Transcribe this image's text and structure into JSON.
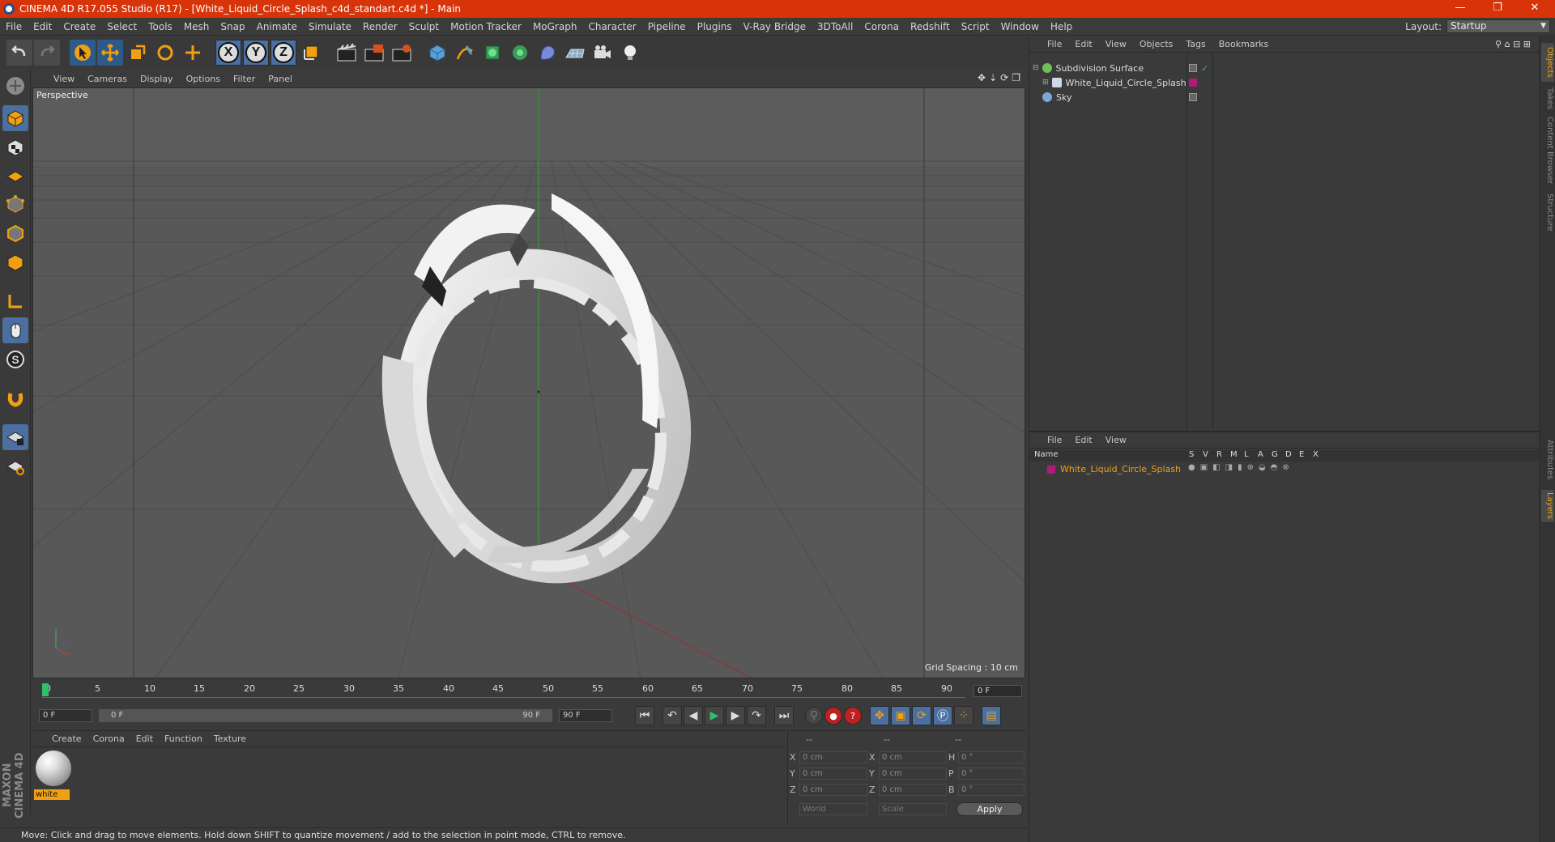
{
  "titlebar": {
    "title": "CINEMA 4D R17.055 Studio (R17) - [White_Liquid_Circle_Splash_c4d_standart.c4d *] - Main",
    "minimize": "—",
    "maximize": "❐",
    "close": "✕"
  },
  "menubar": {
    "items": [
      "File",
      "Edit",
      "Create",
      "Select",
      "Tools",
      "Mesh",
      "Snap",
      "Animate",
      "Simulate",
      "Render",
      "Sculpt",
      "Motion Tracker",
      "MoGraph",
      "Character",
      "Pipeline",
      "Plugins",
      "V-Ray Bridge",
      "3DToAll",
      "Corona",
      "Redshift",
      "Script",
      "Window",
      "Help"
    ],
    "layout_label": "Layout:",
    "layout_value": "Startup"
  },
  "viewport": {
    "menu": [
      "View",
      "Cameras",
      "Display",
      "Options",
      "Filter",
      "Panel"
    ],
    "camera_label": "Perspective",
    "grid_spacing": "Grid Spacing : 10 cm",
    "nav_icons": [
      "move-view-icon",
      "zoom-view-icon",
      "rotate-view-icon",
      "maximize-view-icon"
    ]
  },
  "timeline": {
    "ticks": [
      "0",
      "5",
      "10",
      "15",
      "20",
      "25",
      "30",
      "35",
      "40",
      "45",
      "50",
      "55",
      "60",
      "65",
      "70",
      "75",
      "80",
      "85",
      "90"
    ],
    "current_frame": "0 F",
    "start_field": "0 F",
    "range_start": "0 F",
    "range_end": "90 F",
    "end_field": "90 F"
  },
  "material_panel": {
    "menu": [
      "Create",
      "Corona",
      "Edit",
      "Function",
      "Texture"
    ],
    "material_name": "white"
  },
  "coordinates": {
    "header": [
      "--",
      "--",
      "--"
    ],
    "rows": [
      {
        "a": "X",
        "av": "0 cm",
        "b": "X",
        "bv": "0 cm",
        "c": "H",
        "cv": "0 °"
      },
      {
        "a": "Y",
        "av": "0 cm",
        "b": "Y",
        "bv": "0 cm",
        "c": "P",
        "cv": "0 °"
      },
      {
        "a": "Z",
        "av": "0 cm",
        "b": "Z",
        "bv": "0 cm",
        "c": "B",
        "cv": "0 °"
      }
    ],
    "mode1": "World",
    "mode2": "Scale",
    "apply": "Apply"
  },
  "status": "Move: Click and drag to move elements. Hold down SHIFT to quantize movement / add to the selection in point mode, CTRL to remove.",
  "objects_panel": {
    "menu": [
      "File",
      "Edit",
      "View",
      "Objects",
      "Tags",
      "Bookmarks"
    ],
    "items": [
      {
        "name": "Subdivision Surface",
        "color": "#6fbf5a"
      },
      {
        "name": "White_Liquid_Circle_Splash",
        "color": "#cfd8e6"
      },
      {
        "name": "Sky",
        "color": "#7aa6d8"
      }
    ]
  },
  "layers_panel": {
    "menu": [
      "File",
      "Edit",
      "View"
    ],
    "columns": [
      "Name",
      "S",
      "V",
      "R",
      "M",
      "L",
      "A",
      "G",
      "D",
      "E",
      "X"
    ],
    "layer_name": "White_Liquid_Circle_Splash",
    "layer_color": "#b01a7a"
  },
  "side_tabs": [
    "Objects",
    "Takes",
    "Content Browser",
    "Structure",
    "Attributes",
    "Layers"
  ],
  "maxon": "MAXON CINEMA 4D"
}
